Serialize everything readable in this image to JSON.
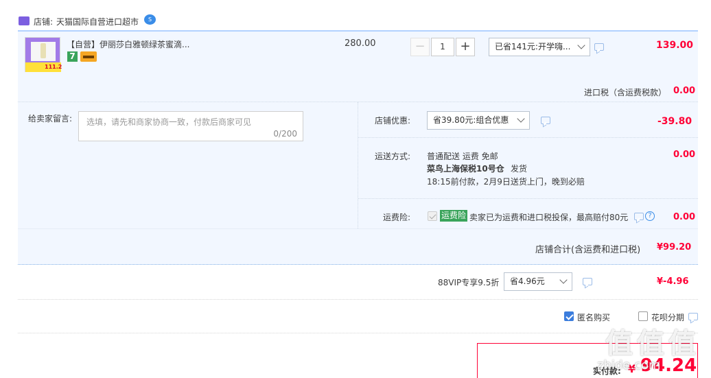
{
  "shop": {
    "label": "店铺:",
    "name": "天猫国际自营进口超市",
    "badge": "S"
  },
  "product": {
    "title": "【自营】伊丽莎白雅顿绿茶蜜滴...",
    "img_price": "111.2",
    "badge_7": "7",
    "unit_price": "280.00",
    "quantity": "1",
    "discount_select": "已省141元:开学嗨...",
    "price": "139.00"
  },
  "import_tax": {
    "label": "进口税（含运费税款）",
    "value": "0.00"
  },
  "message": {
    "label": "给卖家留言:",
    "placeholder": "选填，请先和商家协商一致，付款后商家可见",
    "counter": "0/200"
  },
  "shop_discount": {
    "label": "店铺优惠:",
    "select": "省39.80元:组合优惠",
    "value": "-39.80"
  },
  "shipping": {
    "label": "运送方式:",
    "line1": "普通配送 运费 免邮",
    "line2": "菜鸟上海保税10号仓",
    "line2_suffix": "发货",
    "line3": "18:15前付款，2月9日送货上门，晚到必赔",
    "value": "0.00"
  },
  "insurance": {
    "label": "运费险:",
    "tag": "运费险",
    "text": "卖家已为运费和进口税投保，最高赔付80元",
    "value": "0.00"
  },
  "shop_total": {
    "label": "店铺合计(含运费和进口税)",
    "value": "¥99.20"
  },
  "vip": {
    "label": "88VIP专享9.5折",
    "select": "省4.96元",
    "value": "¥-4.96"
  },
  "options": {
    "anonymous": "匿名购买",
    "huabei": "花呗分期"
  },
  "pay": {
    "label": "实付款:",
    "currency": "¥",
    "value": "94.24"
  },
  "watermark": "值 值 值",
  "watermark_url": "zhide.com",
  "colors": {
    "price_red": "#ff0036",
    "panel_blue": "#f2f7ff",
    "tmall_purple": "#7c5fe0",
    "tag_green": "#3aa45b",
    "check_blue": "#3b7ddd"
  }
}
